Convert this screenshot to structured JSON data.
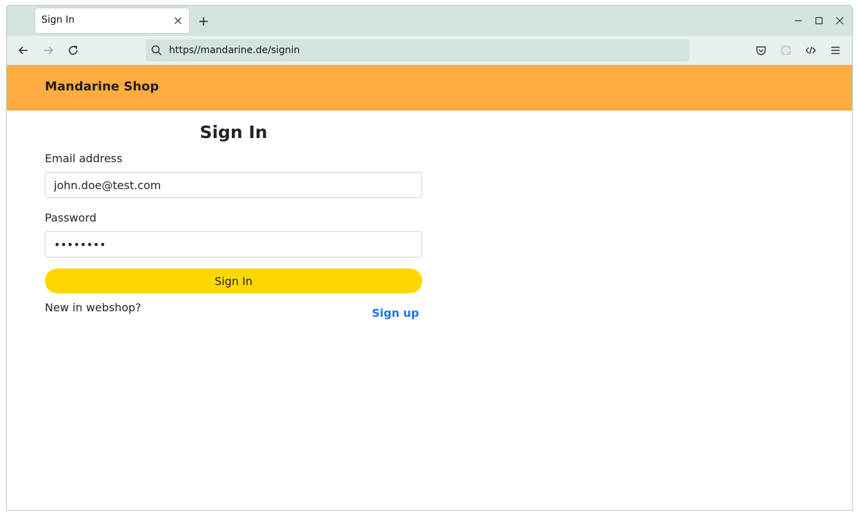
{
  "browser": {
    "tab": {
      "title": "Sign In"
    },
    "url": "https//mandarine.de/signin"
  },
  "site": {
    "brand": "Mandarine Shop"
  },
  "signin": {
    "heading": "Sign In",
    "email_label": "Email address",
    "email_value": "john.doe@test.com",
    "password_label": "Password",
    "password_value": "••••••••",
    "submit_label": "Sign In",
    "new_text": "New in webshop?",
    "signup_label": "Sign up"
  },
  "colors": {
    "header": "#ffac40",
    "button": "#ffd700",
    "link": "#1a73e8",
    "tabstrip": "#d3e4da"
  },
  "icons": [
    "close-icon",
    "plus-icon",
    "minimize-icon",
    "maximize-icon",
    "back-icon",
    "forward-icon",
    "reload-icon",
    "search-icon",
    "pocket-icon",
    "extension-icon",
    "devtools-icon",
    "menu-icon"
  ]
}
